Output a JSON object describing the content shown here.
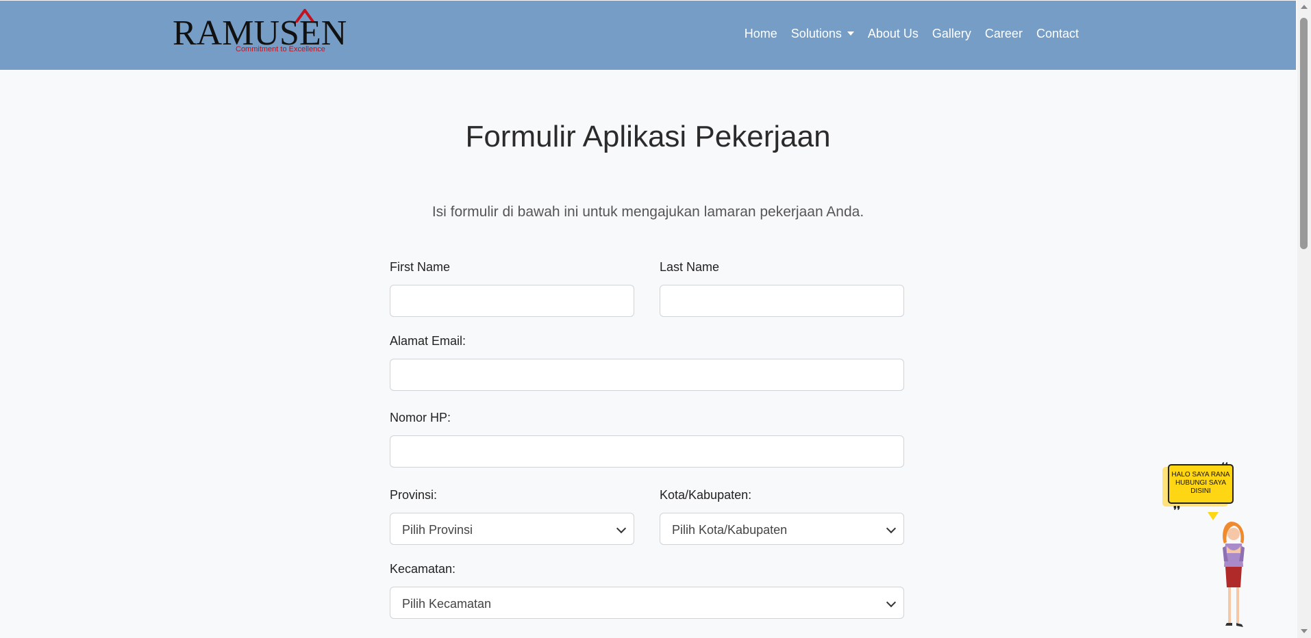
{
  "navbar": {
    "logo_text": "RAMUSEN",
    "logo_tagline": "Commitment to Excellence",
    "items": [
      {
        "label": "Home"
      },
      {
        "label": "Solutions",
        "dropdown": true
      },
      {
        "label": "About Us"
      },
      {
        "label": "Gallery"
      },
      {
        "label": "Career"
      },
      {
        "label": "Contact"
      }
    ]
  },
  "main": {
    "title": "Formulir Aplikasi Pekerjaan",
    "intro": "Isi formulir di bawah ini untuk mengajukan lamaran pekerjaan Anda."
  },
  "form": {
    "first_name_label": "First Name",
    "first_name_value": "",
    "last_name_label": "Last Name",
    "last_name_value": "",
    "email_label": "Alamat Email:",
    "email_value": "",
    "phone_label": "Nomor HP:",
    "phone_value": "",
    "province_label": "Provinsi:",
    "province_selected": "Pilih Provinsi",
    "city_label": "Kota/Kabupaten:",
    "city_selected": "Pilih Kota/Kabupaten",
    "district_label": "Kecamatan:",
    "district_selected": "Pilih Kecamatan"
  },
  "chat_widget": {
    "bubble_text": "HALO SAYA RANA HUBUNGI SAYA DISINI"
  },
  "colors": {
    "navbar_bg": "#759dc5",
    "page_bg": "#f8f9fa",
    "logo_accent": "#c2121f",
    "bubble": "#ffd614"
  }
}
